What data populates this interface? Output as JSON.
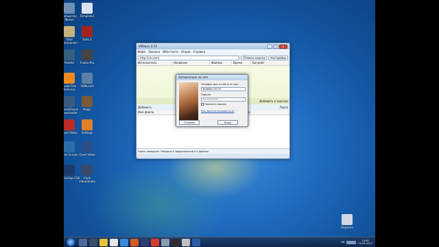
{
  "desktop": {
    "icons": [
      {
        "name": "computer-icon",
        "label": "Компьютер - Ярлык",
        "color": "#6f8fb7"
      },
      {
        "name": "template-icon",
        "label": "Template2",
        "color": "#d9e2ee"
      },
      {
        "name": "total-commander-icon",
        "label": "Total Commander",
        "color": "#c9b27a"
      },
      {
        "name": "dota2-icon",
        "label": "Dota 2",
        "color": "#a2231c"
      },
      {
        "name": "palette-icon",
        "label": "Palette",
        "color": "#35607e"
      },
      {
        "name": "mb-icon",
        "label": "Frame Pro",
        "color": "#444444"
      },
      {
        "name": "avast-icon",
        "label": "Avast Free Antivirus",
        "color": "#f08a1c"
      },
      {
        "name": "vkmusic-icon",
        "label": "VKMusic4",
        "color": "#5c7fa5"
      },
      {
        "name": "sd-icon",
        "label": "SoundCloud Downloader",
        "color": "#3a5b7e"
      },
      {
        "name": "magic-icon",
        "label": "Magic",
        "color": "#7a5c3a"
      },
      {
        "name": "red-icon",
        "label": "Corel Video",
        "color": "#c02a2a"
      },
      {
        "name": "orange-icon",
        "label": "Settings",
        "color": "#e0802a"
      },
      {
        "name": "skype-icon",
        "label": "Corel Screen",
        "color": "#2a6ea8"
      },
      {
        "name": "bluebox-icon",
        "label": "Corel Video",
        "color": "#2b4f8a"
      },
      {
        "name": "photoshop-icon",
        "label": "Photoshop CS6",
        "color": "#1f3b6e"
      },
      {
        "name": "corel-icon",
        "label": "Corel VideoStudio",
        "color": "#3a4b6a"
      }
    ],
    "recycle_bin": {
      "label": "Корзина"
    }
  },
  "app": {
    "title": "VKMusic 4.72",
    "menu": [
      "Файл",
      "Закачка",
      "ВКонтакте",
      "Опции",
      "Справка"
    ],
    "url": "http://vk.com/",
    "search_btn": "Отмена поиска",
    "settings_btn": "Настройки",
    "columns": [
      "Исполнитель",
      "Название",
      "Файлов",
      "Время",
      "Битрейт"
    ],
    "add_btn": "Добавить",
    "add_queue_btn": "Добавить в закачки",
    "pause_btn": "Пауза",
    "lower_columns": [
      "Имя файла",
      "Размер",
      "Статус"
    ],
    "status": "Поиск завершен. Найдено 0 видеозаписей в 0 файлах"
  },
  "dialog": {
    "title": "Авторизация vk.com",
    "login_label": "Телефон или e-mail в vk.com:",
    "login_value": "380688119170",
    "password_label": "Пароль:",
    "password_value": "•••••••••••",
    "show_password": "Показать пароль",
    "register_link": "Как зарегистрироваться?",
    "cancel": "Отмена",
    "login": "Вход"
  },
  "taskbar": {
    "lang": "EN",
    "time": "12:01",
    "date": "10.05.2017"
  }
}
